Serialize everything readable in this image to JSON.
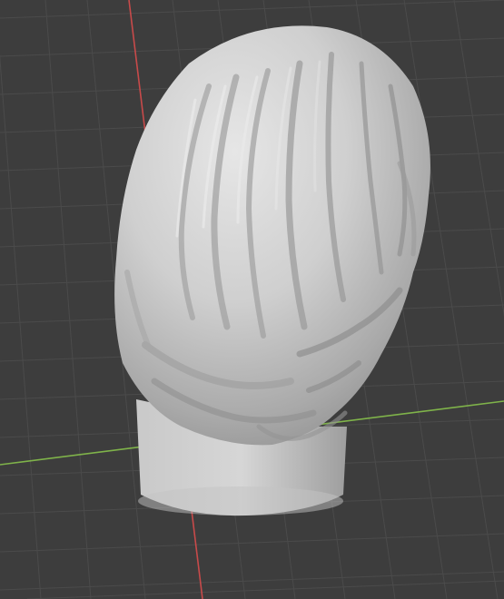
{
  "viewport": {
    "mode": "3d-viewport",
    "shading": "solid",
    "grid_visible": true,
    "x_axis_visible": true,
    "y_axis_visible": true,
    "object": "sculpted-head-bust"
  },
  "colors": {
    "background": "#3d3d3d",
    "grid_line": "#4a4a4a",
    "x_axis": "#c84a4a",
    "y_axis": "#7fb34a",
    "model_light": "#e2e2e2",
    "model_mid": "#b9b9b9",
    "model_dark": "#8e8e8e"
  }
}
